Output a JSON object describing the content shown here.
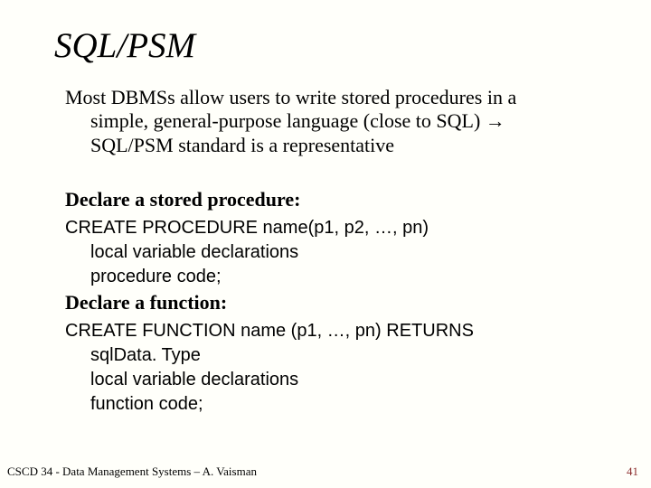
{
  "title": "SQL/PSM",
  "intro": {
    "line1": "Most DBMSs allow users to write stored procedures in a",
    "line2": "simple, general-purpose language (close to SQL) →",
    "line3": "SQL/PSM standard is a representative"
  },
  "proc": {
    "header": "Declare a stored procedure:",
    "sig": "CREATE PROCEDURE name(p1, p2, …, pn)",
    "decl": "local variable declarations",
    "code": "procedure code;"
  },
  "func": {
    "header": "Declare a function:",
    "sig": "CREATE FUNCTION name (p1, …, pn) RETURNS",
    "ret": "sqlData. Type",
    "decl": "local variable declarations",
    "code": "function code;"
  },
  "footer": "CSCD 34 - Data Management Systems – A. Vaisman",
  "pagenum": "41"
}
